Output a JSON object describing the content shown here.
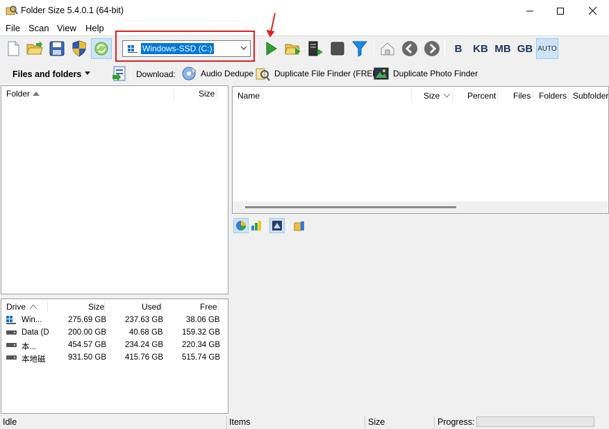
{
  "window": {
    "title": "Folder Size 5.4.0.1 (64-bit)"
  },
  "menu": {
    "items": [
      "File",
      "Scan",
      "View",
      "Help"
    ]
  },
  "toolbar": {
    "drive_selected": "Windows-SSD (C:)",
    "units": [
      "B",
      "KB",
      "MB",
      "GB",
      "AUTO"
    ]
  },
  "toolbar2": {
    "view_mode": "Files and folders",
    "download_label": "Download:",
    "downloads": [
      "Audio Dedupe",
      "Duplicate File Finder (FREE)",
      "Duplicate Photo Finder"
    ]
  },
  "folder_panel": {
    "columns": [
      "Folder",
      "Size"
    ]
  },
  "drives_panel": {
    "columns": [
      "Drive",
      "Size",
      "Used",
      "Free"
    ],
    "rows": [
      {
        "drive": "Win...",
        "size": "275.69 GB",
        "used": "237.63 GB",
        "free": "38.06 GB"
      },
      {
        "drive": "Data (D",
        "size": "200.00 GB",
        "used": "40.68 GB",
        "free": "159.32 GB"
      },
      {
        "drive": "本...",
        "size": "454.57 GB",
        "used": "234.24 GB",
        "free": "220.34 GB"
      },
      {
        "drive": "本地磁",
        "size": "931.50 GB",
        "used": "415.76 GB",
        "free": "515.74 GB"
      }
    ]
  },
  "files_panel": {
    "columns": [
      "Name",
      "Size",
      "Percent",
      "Files",
      "Folders",
      "Subfolders"
    ]
  },
  "status": {
    "state": "Idle",
    "items_label": "Items",
    "size_label": "Size",
    "progress_label": "Progress:"
  },
  "colors": {
    "accent": "#0078d7",
    "highlight_box": "#e02020",
    "pressed_bg": "#cce4f7"
  }
}
